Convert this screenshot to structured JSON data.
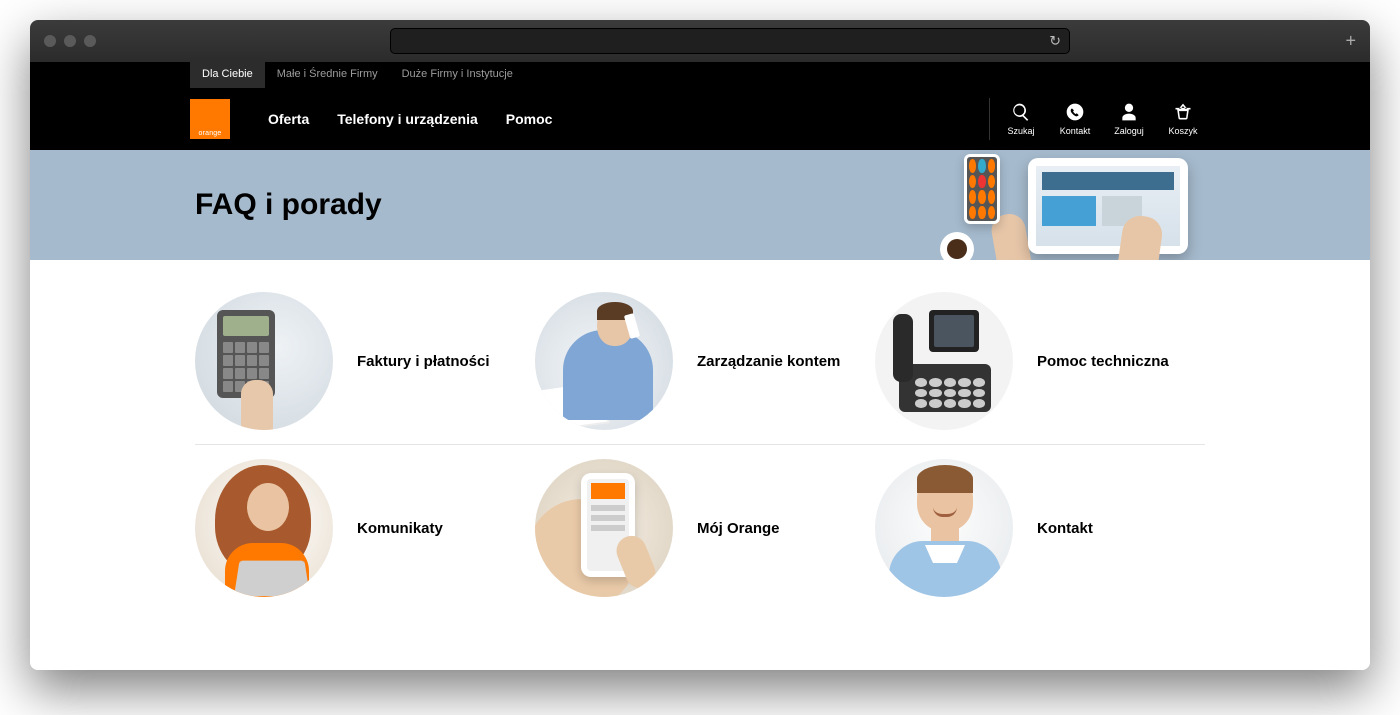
{
  "segments": {
    "items": [
      {
        "label": "Dla Ciebie",
        "active": true
      },
      {
        "label": "Małe i Średnie Firmy",
        "active": false
      },
      {
        "label": "Duże Firmy i Instytucje",
        "active": false
      }
    ]
  },
  "logo": {
    "text": "orange"
  },
  "nav": {
    "links": [
      {
        "label": "Oferta"
      },
      {
        "label": "Telefony i urządzenia"
      },
      {
        "label": "Pomoc"
      }
    ],
    "actions": [
      {
        "label": "Szukaj",
        "icon": "search"
      },
      {
        "label": "Kontakt",
        "icon": "phone"
      },
      {
        "label": "Zaloguj",
        "icon": "user"
      },
      {
        "label": "Koszyk",
        "icon": "basket"
      }
    ]
  },
  "hero": {
    "title": "FAQ i porady"
  },
  "categories": {
    "row1": [
      {
        "label": "Faktury i płatności"
      },
      {
        "label": "Zarządzanie kontem"
      },
      {
        "label": "Pomoc techniczna"
      }
    ],
    "row2": [
      {
        "label": "Komunikaty"
      },
      {
        "label": "Mój Orange"
      },
      {
        "label": "Kontakt"
      }
    ]
  }
}
